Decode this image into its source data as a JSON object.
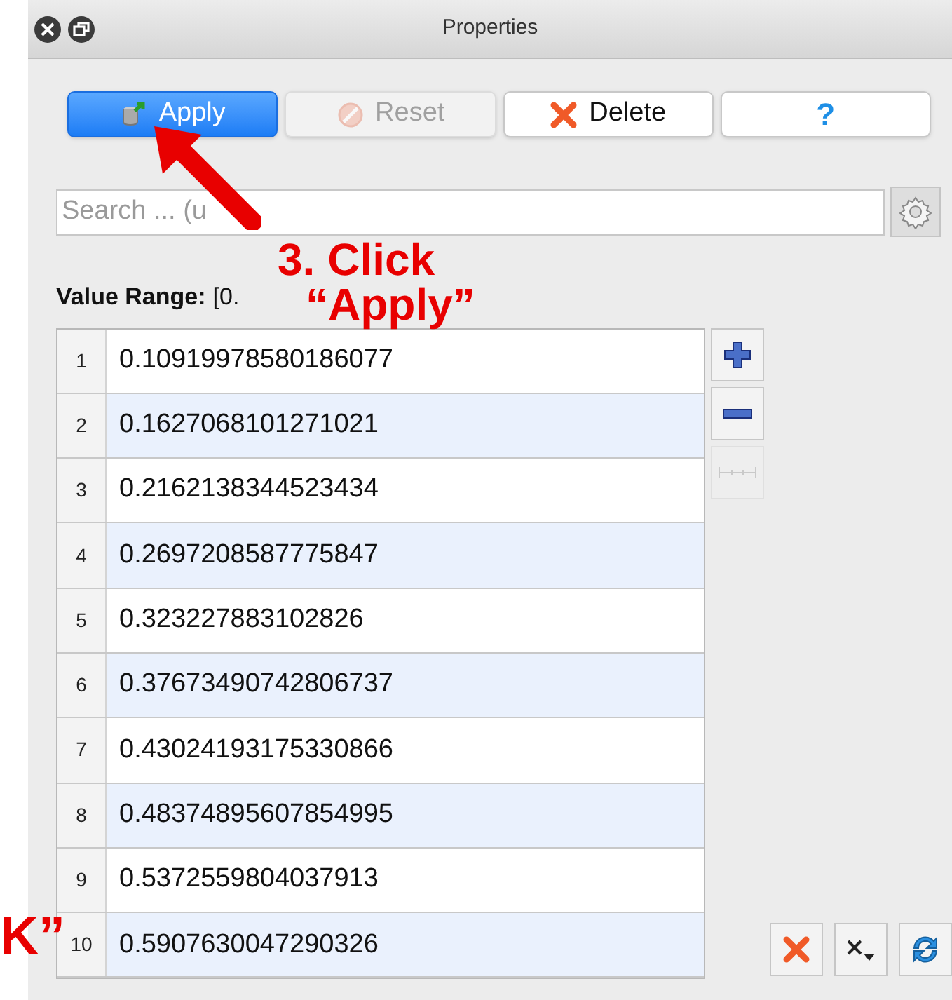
{
  "window": {
    "title": "Properties"
  },
  "toolbar": [
    {
      "kind": "apply",
      "label": "Apply"
    },
    {
      "kind": "reset",
      "label": "Reset",
      "disabled": true
    },
    {
      "kind": "delete",
      "label": "Delete",
      "disabled": false
    },
    {
      "kind": "help",
      "label": "?"
    }
  ],
  "search": {
    "placeholder": "Search ... (u"
  },
  "value_range": {
    "label": "Value Range:",
    "value": "[0."
  },
  "table": {
    "rows": [
      {
        "index": "1",
        "value": "0.10919978580186077"
      },
      {
        "index": "2",
        "value": "0.1627068101271021"
      },
      {
        "index": "3",
        "value": "0.2162138344523434"
      },
      {
        "index": "4",
        "value": "0.2697208587775847"
      },
      {
        "index": "5",
        "value": "0.323227883102826"
      },
      {
        "index": "6",
        "value": "0.37673490742806737"
      },
      {
        "index": "7",
        "value": "0.43024193175330866"
      },
      {
        "index": "8",
        "value": "0.48374895607854995"
      },
      {
        "index": "9",
        "value": "0.5372559804037913"
      },
      {
        "index": "10",
        "value": "0.5907630047290326"
      }
    ]
  },
  "side_buttons": [
    {
      "kind": "add",
      "disabled": false
    },
    {
      "kind": "remove",
      "disabled": false
    },
    {
      "kind": "range",
      "disabled": true
    }
  ],
  "bottom_buttons": [
    {
      "kind": "delete-all"
    },
    {
      "kind": "clear-menu"
    },
    {
      "kind": "refresh"
    }
  ],
  "annotations": [
    {
      "kind": "step",
      "lines": [
        "3. Click",
        "“Apply”"
      ]
    },
    {
      "kind": "fragment",
      "lines": [
        "K”"
      ]
    }
  ]
}
